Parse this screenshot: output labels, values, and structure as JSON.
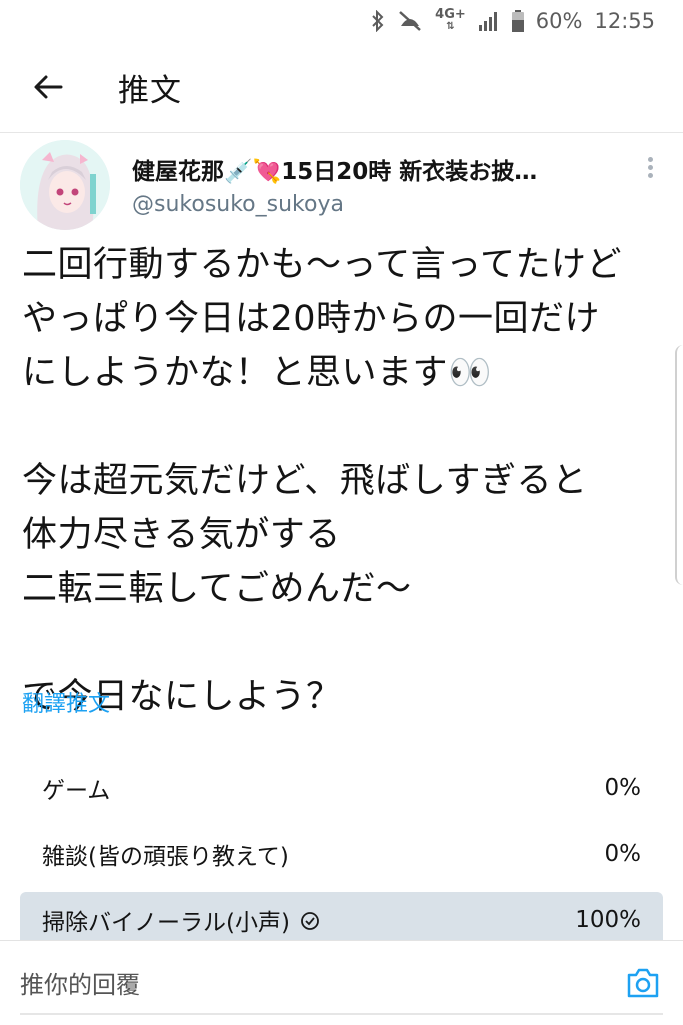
{
  "status_bar": {
    "network": "4G+",
    "battery_pct": "60%",
    "time": "12:55"
  },
  "app_bar": {
    "title": "推文"
  },
  "tweet": {
    "author_name": "健屋花那💉💘15日20時 新衣装お披…",
    "author_handle": "@sukosuko_sukoya",
    "text": "二回行動するかも〜って言ってたけど\nやっぱり今日は20時からの一回だけ\nにしようかな！と思います👀\n\n今は超元気だけど、飛ばしすぎると\n体力尽きる気がする\n二転三転してごめんだ〜\n\nで今日なにしよう？",
    "translate_label": "翻譯推文"
  },
  "poll": {
    "options": [
      {
        "label": "ゲーム",
        "percent_text": "0%",
        "fraction": 0,
        "selected": false
      },
      {
        "label": "雑談(皆の頑張り教えて)",
        "percent_text": "0%",
        "fraction": 0,
        "selected": false
      },
      {
        "label": "掃除バイノーラル(小声)",
        "percent_text": "100%",
        "fraction": 1,
        "selected": true
      }
    ]
  },
  "reply": {
    "placeholder": "推你的回覆"
  },
  "colors": {
    "accent": "#1da1f2",
    "poll_fill": "#d9e1e8",
    "handle_gray": "#657786"
  },
  "icons": [
    "bluetooth-icon",
    "mute-icon",
    "signal-icon",
    "battery-icon",
    "back-arrow-icon",
    "more-vertical-icon",
    "check-circle-icon",
    "camera-icon"
  ]
}
